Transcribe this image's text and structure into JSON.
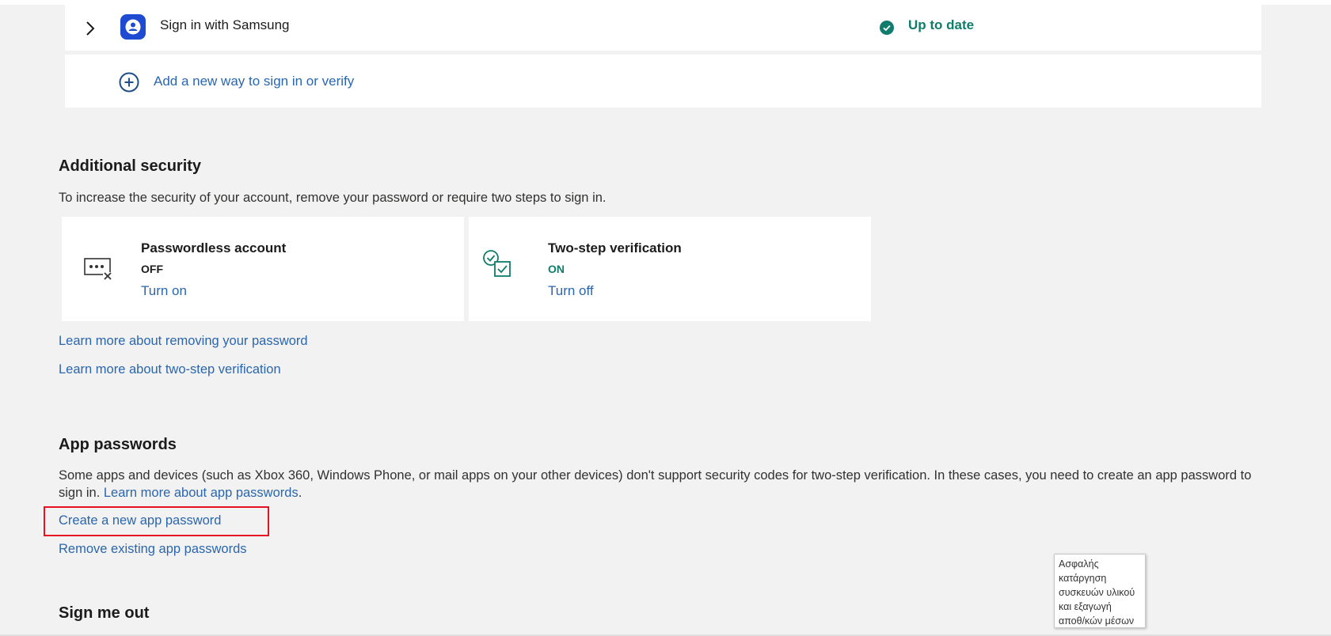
{
  "methods": {
    "samsung": {
      "label": "Sign in with Samsung",
      "status": "Up to date"
    },
    "add_new": {
      "label": "Add a new way to sign in or verify"
    }
  },
  "additional_security": {
    "title": "Additional security",
    "description": "To increase the security of your account, remove your password or require two steps to sign in.",
    "cards": [
      {
        "title": "Passwordless account",
        "state": "OFF",
        "action": "Turn on"
      },
      {
        "title": "Two-step verification",
        "state": "ON",
        "action": "Turn off"
      }
    ],
    "links": [
      "Learn more about removing your password",
      "Learn more about two-step verification"
    ]
  },
  "app_passwords": {
    "title": "App passwords",
    "description_line1": "Some apps and devices (such as Xbox 360, Windows Phone, or mail apps on your other devices) don't support security codes for two-step verification. In these cases, you need to create an app password to",
    "description_line2_prefix": "sign in. ",
    "description_link": "Learn more about app passwords",
    "description_suffix": ".",
    "create_link": "Create a new app password",
    "remove_link": "Remove existing app passwords"
  },
  "sign_out": {
    "title": "Sign me out"
  },
  "tooltip": {
    "lines": [
      "Ασφαλής",
      "κατάργηση",
      "συσκευών υλικού",
      "και εξαγωγή",
      "αποθ/κών μέσων"
    ]
  },
  "colors": {
    "accent": "#2b66ad",
    "success": "#107c6c",
    "samsung_blue": "#1e4bd2",
    "highlight": "#e81123"
  },
  "icons": {
    "chevron": "chevron-right-icon",
    "samsung": "samsung-account-icon",
    "status": "check-circle-icon",
    "add": "plus-circle-icon",
    "passwordless": "password-off-icon",
    "two_step": "two-step-check-icon"
  }
}
